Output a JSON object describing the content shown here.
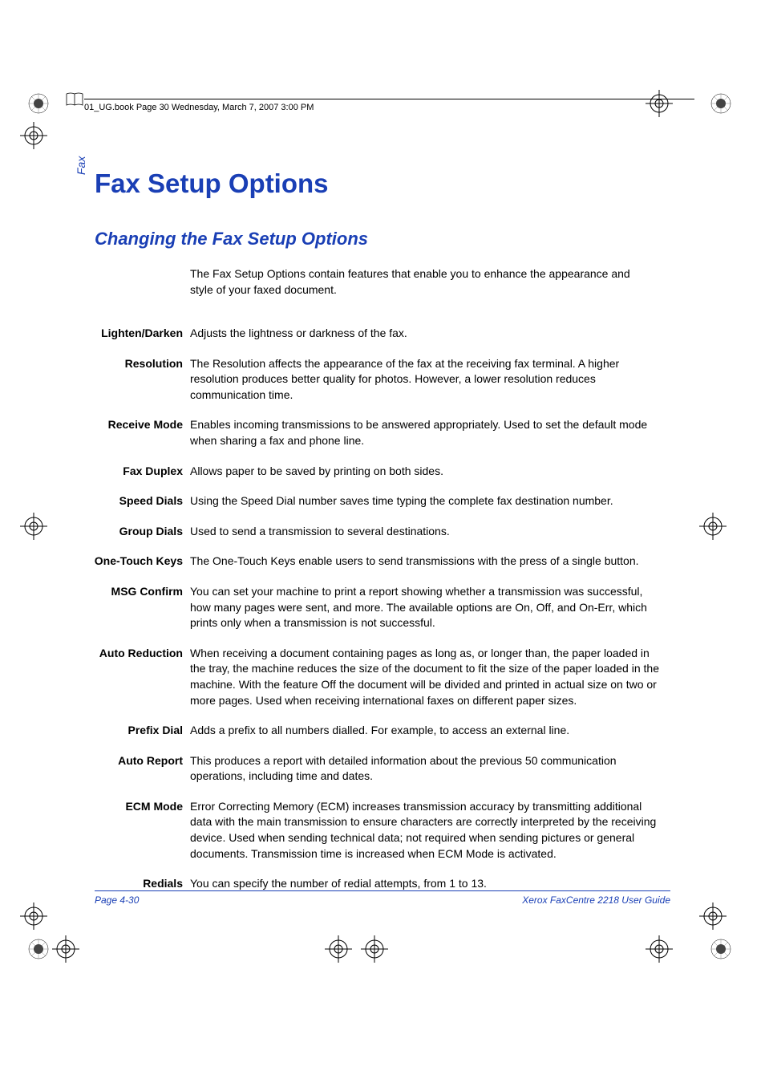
{
  "header_text": "01_UG.book  Page 30  Wednesday, March 7, 2007  3:00 PM",
  "side_tab": "Fax",
  "title": "Fax Setup Options",
  "subtitle": "Changing the Fax Setup Options",
  "intro": "The Fax Setup Options contain features that enable you to enhance the appearance and style of your faxed document.",
  "definitions": [
    {
      "term": "Lighten/Darken",
      "desc": "Adjusts the lightness or darkness of the fax."
    },
    {
      "term": "Resolution",
      "desc": "The Resolution affects the appearance of the fax at the receiving fax terminal. A higher resolution produces better quality for photos. However, a lower resolution reduces communication time."
    },
    {
      "term": "Receive Mode",
      "desc": "Enables incoming transmissions to be answered appropriately. Used to set the default mode when sharing a fax and phone line."
    },
    {
      "term": "Fax Duplex",
      "desc": "Allows paper to be saved by printing on both sides."
    },
    {
      "term": "Speed Dials",
      "desc": "Using the Speed Dial number saves time typing the complete fax destination number."
    },
    {
      "term": "Group Dials",
      "desc": "Used to send a transmission to several destinations."
    },
    {
      "term": "One-Touch Keys",
      "desc": "The One-Touch Keys enable users to send transmissions with the press of a single button."
    },
    {
      "term": "MSG Confirm",
      "desc": "You can set your machine to print a report showing whether a transmission was successful, how many pages were sent, and more. The available options are On, Off, and On-Err, which prints only when a transmission is not successful."
    },
    {
      "term": "Auto Reduction",
      "desc": "When receiving a document containing pages as long as, or longer than, the paper loaded in the tray, the machine reduces the size of the document to fit the size of the paper loaded in the machine. With the feature Off the document will be divided and printed in actual size on two or more pages. Used when receiving international faxes on different paper sizes."
    },
    {
      "term": "Prefix Dial",
      "desc": "Adds a prefix to all numbers dialled. For example, to access an external line."
    },
    {
      "term": "Auto Report",
      "desc": "This produces a report with detailed information about the previous 50 communication operations, including time and dates."
    },
    {
      "term": "ECM Mode",
      "desc": "Error Correcting Memory (ECM) increases transmission accuracy by transmitting additional data with the main transmission to ensure characters are correctly interpreted by the receiving device. Used when sending technical data; not required when sending pictures or general documents. Transmission time is increased when ECM Mode is activated."
    },
    {
      "term": "Redials",
      "desc": "You can specify the number of redial attempts, from 1 to 13."
    }
  ],
  "footer_left": "Page 4-30",
  "footer_right": "Xerox FaxCentre 2218 User Guide"
}
